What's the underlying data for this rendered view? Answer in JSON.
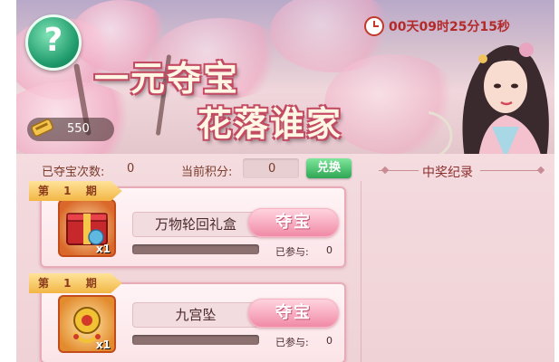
{
  "timer": {
    "text": "00天09时25分15秒"
  },
  "banner": {
    "title_line1": "一元夺宝",
    "title_line2": "花落谁家"
  },
  "currency": {
    "amount": "550"
  },
  "stats": {
    "won_count_label": "已夺宝次数:",
    "won_count_value": "0",
    "points_label": "当前积分:",
    "points_value": "0",
    "exchange_label": "兑换"
  },
  "winners": {
    "title": "中奖纪录"
  },
  "periods": [
    {
      "tag": "第 1 期",
      "item_name": "万物轮回礼盒",
      "qty": "x1",
      "progress": 0,
      "button": "夺宝",
      "joined_label": "已参与:",
      "joined_value": "0"
    },
    {
      "tag": "第 1 期",
      "item_name": "九宫坠",
      "qty": "x1",
      "progress": 0,
      "button": "夺宝",
      "joined_label": "已参与:",
      "joined_value": "0"
    }
  ],
  "colors": {
    "accent": "#f18aa6",
    "exchange_green": "#2fa653",
    "text_brown": "#7a3b2b"
  },
  "icons": {
    "help": "question-mark-icon",
    "clock": "clock-icon",
    "coin": "gold-scroll-icon"
  }
}
